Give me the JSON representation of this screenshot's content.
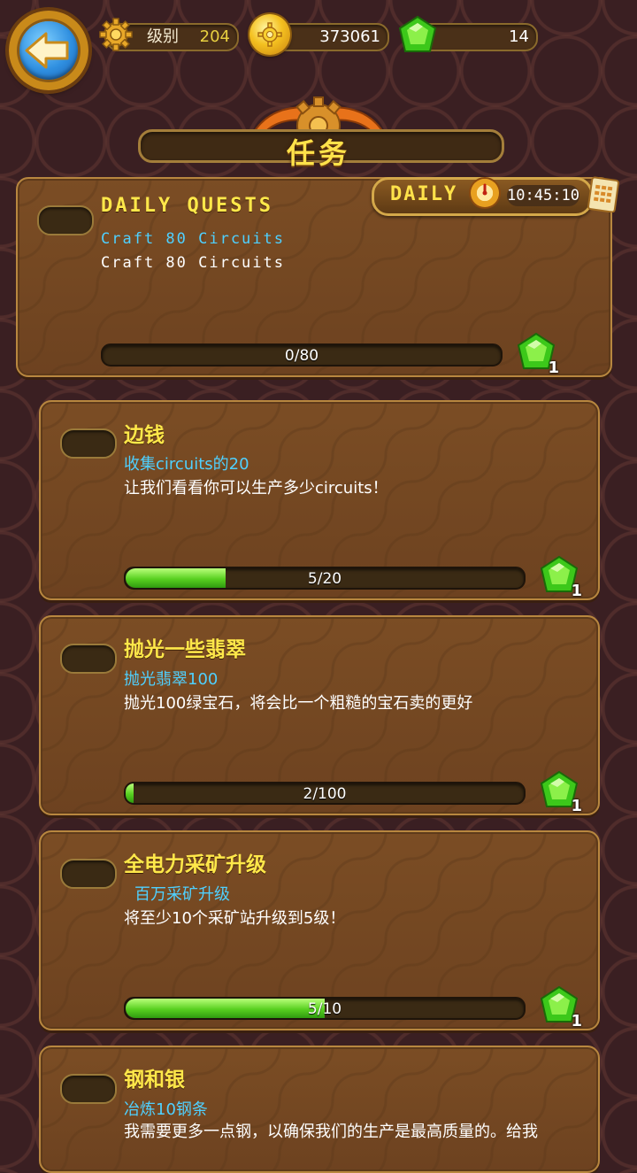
{
  "header": {
    "level_label": "级别",
    "level_value": "204",
    "coins_value": "373061",
    "gems_value": "14"
  },
  "title": "任务",
  "daily": {
    "badge_label": "DAILY",
    "timer": "10:45:10",
    "title": "DAILY QUESTS",
    "subtitle": "Craft 80 Circuits",
    "description": "Craft 80 Circuits",
    "progress_text": "0/80",
    "progress": 0.0,
    "reward": "1"
  },
  "quests": [
    {
      "title": "边钱",
      "subtitle": "收集circuits的20",
      "description": "让我们看看你可以生产多少circuits！",
      "progress_text": "5/20",
      "progress": 0.25,
      "reward": "1"
    },
    {
      "title": "抛光一些翡翠",
      "subtitle": "抛光翡翠100",
      "description": "抛光100绿宝石，将会比一个粗糙的宝石卖的更好",
      "progress_text": "2/100",
      "progress": 0.02,
      "reward": "1"
    },
    {
      "title": "全电力采矿升级",
      "subtitle": "百万采矿升级",
      "description": "将至少10个采矿站升级到5级！",
      "progress_text": "5/10",
      "progress": 0.5,
      "reward": "1"
    },
    {
      "title": "钢和银",
      "subtitle": "冶炼10钢条",
      "description": "我需要更多一点钢，以确保我们的生产是最高质量的。给我"
    }
  ],
  "colors": {
    "title_yellow": "#ffe84a",
    "subtitle_cyan": "#4fd0ff",
    "progress_green": "#58d020",
    "card_brown": "#7b4d24"
  },
  "icons": [
    "back-arrow-icon",
    "gear-icon",
    "coin-icon",
    "gem-icon",
    "clock-icon",
    "calendar-icon"
  ]
}
